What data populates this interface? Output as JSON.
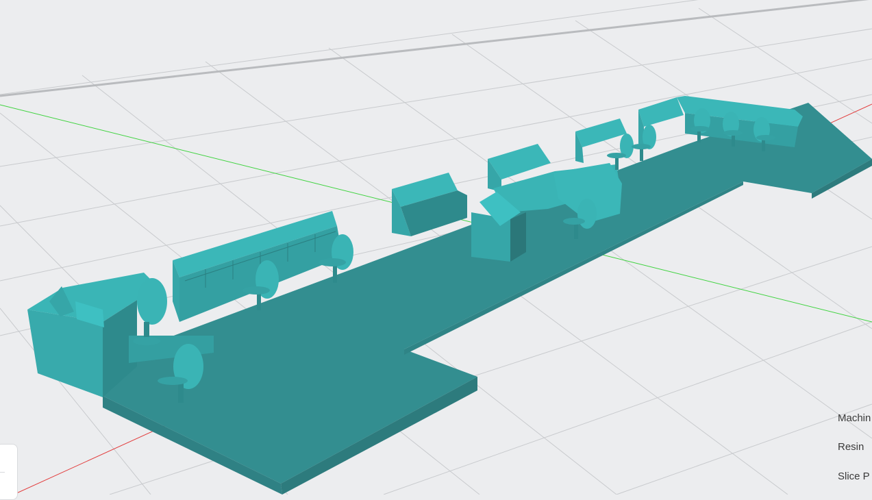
{
  "viewport": {
    "name": "3d-model-viewport",
    "model_color": "#36a6a8",
    "background": "#ecedef",
    "axis_colors": {
      "x": "#e23b3b",
      "y": "#3fd33f"
    }
  },
  "info_panel": {
    "machine_label": "Machin",
    "resin_label": "Resin",
    "slice_label": "Slice P"
  }
}
